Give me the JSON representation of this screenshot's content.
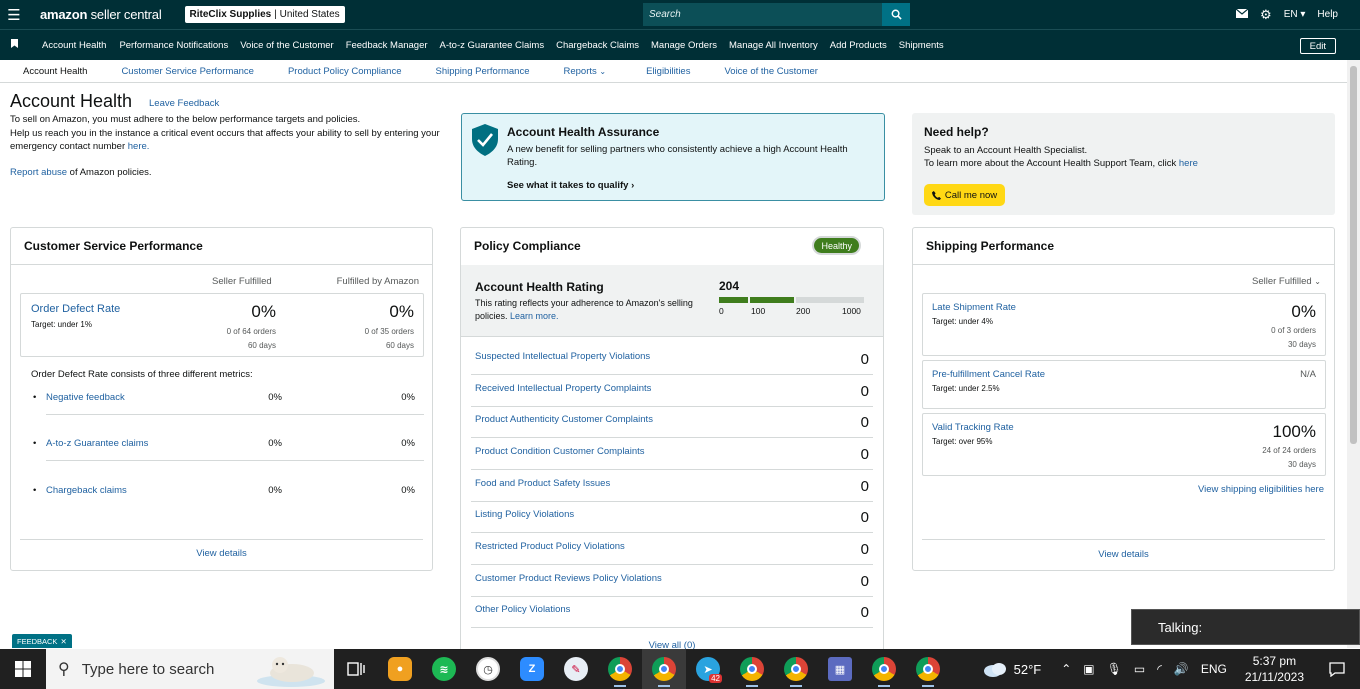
{
  "topbar": {
    "logo_main": "amazon",
    "logo_sub": "seller central",
    "store_name": "RiteClix Supplies",
    "store_region": "United States",
    "search_placeholder": "Search",
    "lang": "EN",
    "help": "Help"
  },
  "nav": {
    "items": [
      "Account Health",
      "Performance Notifications",
      "Voice of the Customer",
      "Feedback Manager",
      "A-to-z Guarantee Claims",
      "Chargeback Claims",
      "Manage Orders",
      "Manage All Inventory",
      "Add Products",
      "Shipments"
    ],
    "edit": "Edit"
  },
  "subtabs": [
    "Account Health",
    "Customer Service Performance",
    "Product Policy Compliance",
    "Shipping Performance",
    "Reports",
    "Eligibilities",
    "Voice of the Customer"
  ],
  "header": {
    "title": "Account Health",
    "leave_feedback": "Leave Feedback",
    "intro_1": "To sell on Amazon, you must adhere to the below performance targets and policies.",
    "intro_2": "Help us reach you in the instance a critical event occurs that affects your ability to sell by entering your emergency contact number",
    "intro_link": "here.",
    "report_link": "Report abuse",
    "report_rest": " of Amazon policies."
  },
  "assurance": {
    "title": "Account Health Assurance",
    "desc": "A new benefit for selling partners who consistently achieve a high Account Health Rating.",
    "link": "See what it takes to qualify"
  },
  "need_help": {
    "title": "Need help?",
    "line1": "Speak to an Account Health Specialist.",
    "line2": "To learn more about the Account Health Support Team, click",
    "line2_link": "here",
    "call": "Call me now"
  },
  "csp": {
    "title": "Customer Service Performance",
    "col_seller": "Seller Fulfilled",
    "col_fba": "Fulfilled by Amazon",
    "odr_title": "Order Defect Rate",
    "odr_target": "Target: under 1%",
    "seller_value": "0%",
    "seller_orders": "0 of 64 orders",
    "seller_days": "60 days",
    "fba_value": "0%",
    "fba_orders": "0 of 35 orders",
    "fba_days": "60 days",
    "consists": "Order Defect Rate consists of three different metrics:",
    "metrics": [
      {
        "name": "Negative feedback",
        "seller": "0%",
        "fba": "0%"
      },
      {
        "name": "A-to-z Guarantee claims",
        "seller": "0%",
        "fba": "0%"
      },
      {
        "name": "Chargeback claims",
        "seller": "0%",
        "fba": "0%"
      }
    ],
    "view_details": "View details"
  },
  "policy": {
    "title": "Policy Compliance",
    "status": "Healthy",
    "ahr_title": "Account Health Rating",
    "ahr_desc": "This rating reflects your adherence to Amazon's selling policies.",
    "ahr_learn": "Learn more.",
    "score": "204",
    "score_value": 204,
    "ticks": [
      "0",
      "100",
      "200",
      "1000"
    ],
    "rows": [
      {
        "name": "Suspected Intellectual Property Violations",
        "value": "0"
      },
      {
        "name": "Received Intellectual Property Complaints",
        "value": "0"
      },
      {
        "name": "Product Authenticity Customer Complaints",
        "value": "0"
      },
      {
        "name": "Product Condition Customer Complaints",
        "value": "0"
      },
      {
        "name": "Food and Product Safety Issues",
        "value": "0"
      },
      {
        "name": "Listing Policy Violations",
        "value": "0"
      },
      {
        "name": "Restricted Product Policy Violations",
        "value": "0"
      },
      {
        "name": "Customer Product Reviews Policy Violations",
        "value": "0"
      },
      {
        "name": "Other Policy Violations",
        "value": "0"
      }
    ],
    "view_all": "View all (0)",
    "colors": {
      "healthy": "#3f7d1d",
      "bar_fill": "#3f7d1d",
      "bar_empty": "#d5d9d9"
    }
  },
  "shipping": {
    "title": "Shipping Performance",
    "filter": "Seller Fulfilled",
    "metrics": [
      {
        "name": "Late Shipment Rate",
        "target": "Target: under 4%",
        "value": "0%",
        "orders": "0 of 3 orders",
        "days": "30 days"
      },
      {
        "name": "Pre-fulfillment Cancel Rate",
        "target": "Target: under 2.5%",
        "value": "N/A",
        "orders": "",
        "days": ""
      },
      {
        "name": "Valid Tracking Rate",
        "target": "Target: over 95%",
        "value": "100%",
        "orders": "24 of 24 orders",
        "days": "30 days"
      }
    ],
    "eligibilities": "View shipping eligibilities here",
    "view_details": "View details"
  },
  "feedback_tab": "FEEDBACK",
  "talking": "Talking:",
  "taskbar": {
    "search": "Type here to search",
    "temp": "52°F",
    "lang": "ENG",
    "time": "5:37 pm",
    "date": "21/11/2023",
    "telegram_badge": "42"
  },
  "icons": [
    "hamburger-icon",
    "search-icon",
    "mail-icon",
    "gear-icon",
    "bookmark-icon",
    "shield-check-icon",
    "phone-icon",
    "windows-icon",
    "chrome-icon"
  ]
}
